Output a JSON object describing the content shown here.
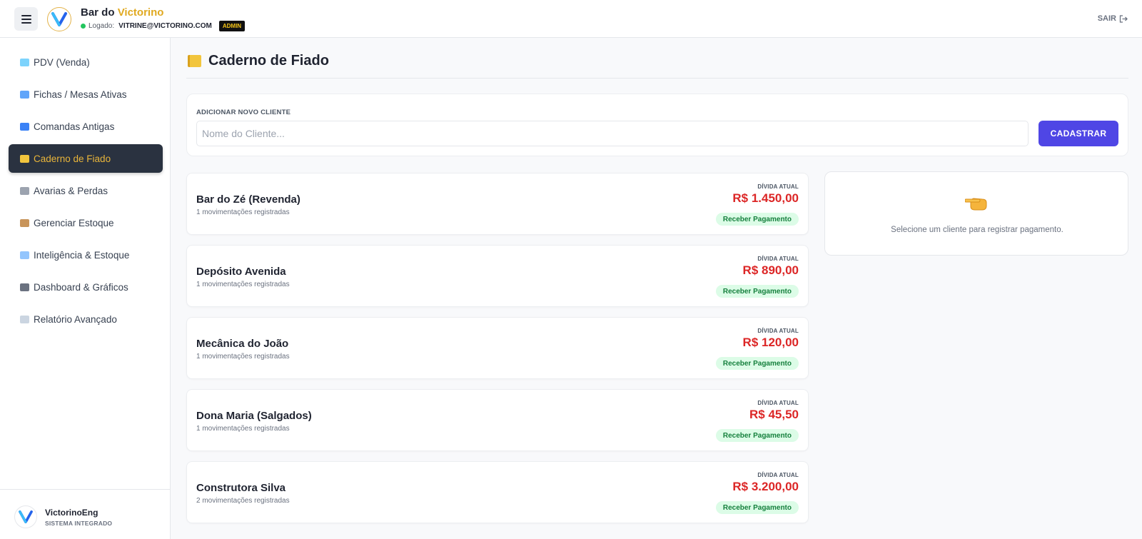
{
  "header": {
    "brand_main": "Bar do",
    "brand_accent": "Victorino",
    "login_label": "Logado:",
    "login_email": "VITRINE@VICTORINO.COM",
    "role_badge": "ADMIN",
    "logout_label": "SAIR"
  },
  "sidebar": {
    "items": [
      {
        "label": "PDV (Venda)",
        "icon": "cart-icon"
      },
      {
        "label": "Fichas / Mesas Ativas",
        "icon": "map-icon"
      },
      {
        "label": "Comandas Antigas",
        "icon": "card-icon"
      },
      {
        "label": "Caderno de Fiado",
        "icon": "notebook-icon"
      },
      {
        "label": "Avarias & Perdas",
        "icon": "trash-icon"
      },
      {
        "label": "Gerenciar Estoque",
        "icon": "package-icon"
      },
      {
        "label": "Inteligência & Estoque",
        "icon": "trend-icon"
      },
      {
        "label": "Dashboard & Gráficos",
        "icon": "bar-chart-icon"
      },
      {
        "label": "Relatório Avançado",
        "icon": "report-icon"
      }
    ],
    "active_index": 3,
    "footer": {
      "name": "VictorinoEng",
      "subtitle": "SISTEMA INTEGRADO"
    }
  },
  "main": {
    "title": "Caderno de Fiado",
    "add_client": {
      "label": "ADICIONAR NOVO CLIENTE",
      "placeholder": "Nome do Cliente...",
      "value": "",
      "button_label": "CADASTRAR"
    },
    "debt_label": "DÍVIDA ATUAL",
    "pay_label": "Receber Pagamento",
    "clients": [
      {
        "name": "Bar do Zé (Revenda)",
        "moves": "1 movimentações registradas",
        "debt": "R$ 1.450,00"
      },
      {
        "name": "Depósito Avenida",
        "moves": "1 movimentações registradas",
        "debt": "R$ 890,00"
      },
      {
        "name": "Mecânica do João",
        "moves": "1 movimentações registradas",
        "debt": "R$ 120,00"
      },
      {
        "name": "Dona Maria (Salgados)",
        "moves": "1 movimentações registradas",
        "debt": "R$ 45,50"
      },
      {
        "name": "Construtora Silva",
        "moves": "2 movimentações registradas",
        "debt": "R$ 3.200,00"
      }
    ],
    "side_panel": {
      "icon": "pointing-hand-icon",
      "text": "Selecione um cliente para registrar pagamento."
    }
  },
  "colors": {
    "accent": "#4f46e5",
    "brand_gold": "#e0a920",
    "debt_red": "#dc2626",
    "success_green": "#15803d",
    "sidebar_active": "#2a3240"
  }
}
